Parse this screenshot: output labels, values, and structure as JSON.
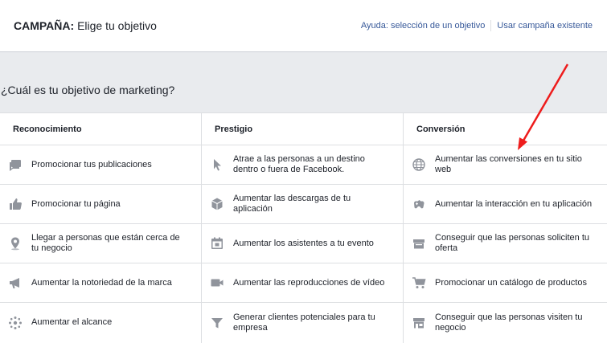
{
  "header": {
    "title_bold": "CAMPAÑA:",
    "title_rest": " Elige tu objetivo",
    "help_link": "Ayuda: selección de un objetivo",
    "existing_link": "Usar campaña existente"
  },
  "question": "¿Cuál es tu objetivo de marketing?",
  "columns": [
    {
      "title": "Reconocimiento",
      "items": [
        {
          "label": "Promocionar tus publicaciones",
          "icon": "posts-icon"
        },
        {
          "label": "Promocionar tu página",
          "icon": "thumbs-up-icon"
        },
        {
          "label": "Llegar a personas que están cerca de tu negocio",
          "icon": "location-pin-icon"
        },
        {
          "label": "Aumentar la notoriedad de la marca",
          "icon": "megaphone-icon"
        },
        {
          "label": "Aumentar el alcance",
          "icon": "reach-icon"
        }
      ]
    },
    {
      "title": "Prestigio",
      "items": [
        {
          "label": "Atrae a las personas a un destino dentro o fuera de Facebook.",
          "icon": "cursor-icon"
        },
        {
          "label": "Aumentar las descargas de tu aplicación",
          "icon": "app-box-icon"
        },
        {
          "label": "Aumentar los asistentes a tu evento",
          "icon": "calendar-icon"
        },
        {
          "label": "Aumentar las reproducciones de vídeo",
          "icon": "video-camera-icon"
        },
        {
          "label": "Generar clientes potenciales para tu empresa",
          "icon": "funnel-icon"
        }
      ]
    },
    {
      "title": "Conversión",
      "items": [
        {
          "label": "Aumentar las conversiones en tu sitio web",
          "icon": "globe-icon"
        },
        {
          "label": "Aumentar la interacción en tu aplicación",
          "icon": "gamepad-icon"
        },
        {
          "label": "Conseguir que las personas soliciten tu oferta",
          "icon": "offer-icon"
        },
        {
          "label": "Promocionar un catálogo de productos",
          "icon": "cart-icon"
        },
        {
          "label": "Conseguir que las personas visiten tu negocio",
          "icon": "store-icon"
        }
      ]
    }
  ],
  "colors": {
    "icon": "#90949c",
    "link": "#365899",
    "annotation_arrow": "#ee1c1c"
  }
}
